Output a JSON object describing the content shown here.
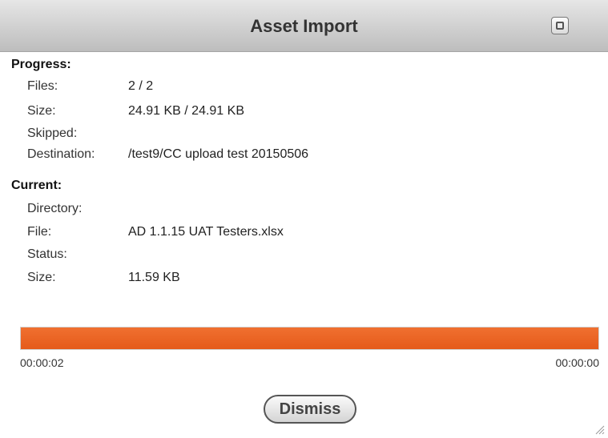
{
  "window": {
    "title": "Asset Import",
    "restore_icon": "window-restore-icon"
  },
  "progress": {
    "heading": "Progress:",
    "rows": [
      {
        "label": "Files:",
        "value": "2 / 2"
      },
      {
        "label": "Size:",
        "value": "24.91 KB / 24.91 KB"
      },
      {
        "label": "Skipped:",
        "value": ""
      },
      {
        "label": "Destination:",
        "value": "/test9/CC upload test 20150506"
      }
    ]
  },
  "current": {
    "heading": "Current:",
    "rows": [
      {
        "label": "Directory:",
        "value": ""
      },
      {
        "label": "File:",
        "value": "AD 1.1.15 UAT Testers.xlsx"
      },
      {
        "label": "Status:",
        "value": ""
      },
      {
        "label": "Size:",
        "value": "11.59 KB"
      }
    ]
  },
  "progress_bar": {
    "percent": 100,
    "color": "#E85D1F",
    "elapsed": "00:00:02",
    "remaining": "00:00:00"
  },
  "actions": {
    "dismiss_label": "Dismiss"
  },
  "colors": {
    "title_bar": "#C8C8C8",
    "accent": "#E85D1F"
  }
}
